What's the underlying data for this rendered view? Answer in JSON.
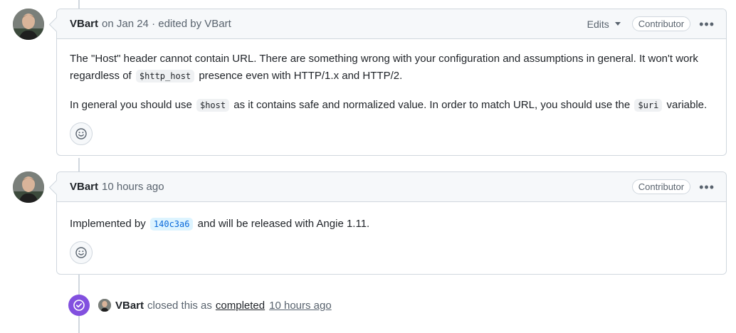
{
  "comments": [
    {
      "author": "VBart",
      "meta": "on Jan 24 · edited by VBart",
      "edits_label": "Edits",
      "badge": "Contributor",
      "paragraph1": {
        "t1": "The \"Host\" header cannot contain URL. There are something wrong with your configuration and assumptions in general. It won't work regardless of",
        "code": "$http_host",
        "t2": "presence even with HTTP/1.x and HTTP/2."
      },
      "paragraph2": {
        "t1": "In general you should use",
        "code1": "$host",
        "t2": "as it contains safe and normalized value. In order to match URL, you should use the",
        "code2": "$uri",
        "t3": "variable."
      }
    },
    {
      "author": "VBart",
      "meta": "10 hours ago",
      "badge": "Contributor",
      "body": {
        "t1": "Implemented by",
        "commit": "140c3a6",
        "t2": "and will be released with Angie 1.11."
      }
    }
  ],
  "event": {
    "author": "VBart",
    "text": "closed this as",
    "status_link": "completed",
    "time": "10 hours ago"
  },
  "colors": {
    "closed_purple": "#8250df",
    "link_blue": "#0969da"
  },
  "icons": [
    "avatar",
    "triangle-down-icon",
    "kebab-horizontal-icon",
    "smiley-icon",
    "check-circle-icon"
  ]
}
